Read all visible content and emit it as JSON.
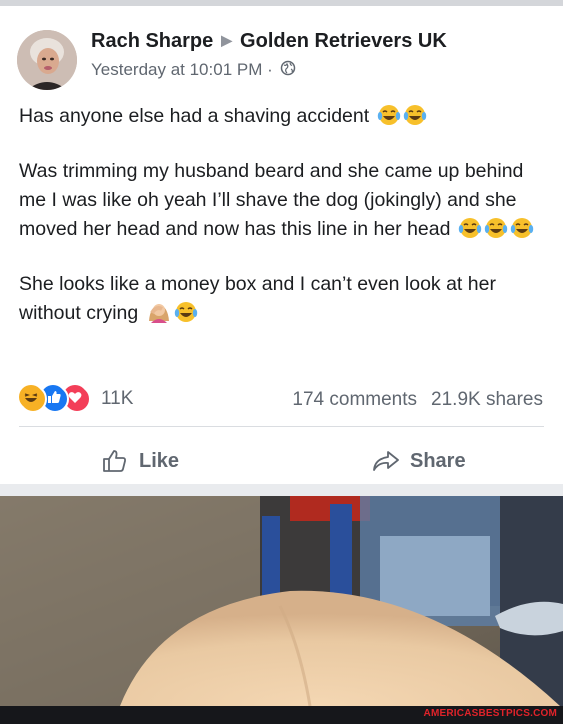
{
  "post": {
    "author": "Rach Sharpe",
    "group": "Golden Retrievers UK",
    "timestamp": "Yesterday at 10:01 PM",
    "separator": "·",
    "privacy_icon": "globe-icon",
    "paragraphs": [
      "Has anyone else had a shaving accident",
      "Was trimming my husband beard and she came up behind me I was like oh yeah I’ll shave the dog (jokingly) and she moved her head and now has this line in her head",
      "She looks like a money box and I can’t even look at her without crying"
    ],
    "emoji": [
      "face-with-tears-of-joy",
      "person-facepalming"
    ]
  },
  "reactions": {
    "icons": [
      "haha-icon",
      "like-icon",
      "love-icon"
    ],
    "count": "11K",
    "comments": "174 comments",
    "shares": "21.9K shares"
  },
  "actions": {
    "like_label": "Like",
    "share_label": "Share"
  },
  "watermark": "AMERICASBESTPICS.COM",
  "colors": {
    "background": "#e9ebee",
    "secondary_text": "#606770",
    "like_blue": "#1877f2",
    "love_red": "#f33e58",
    "haha_yellow": "#f7b125"
  }
}
